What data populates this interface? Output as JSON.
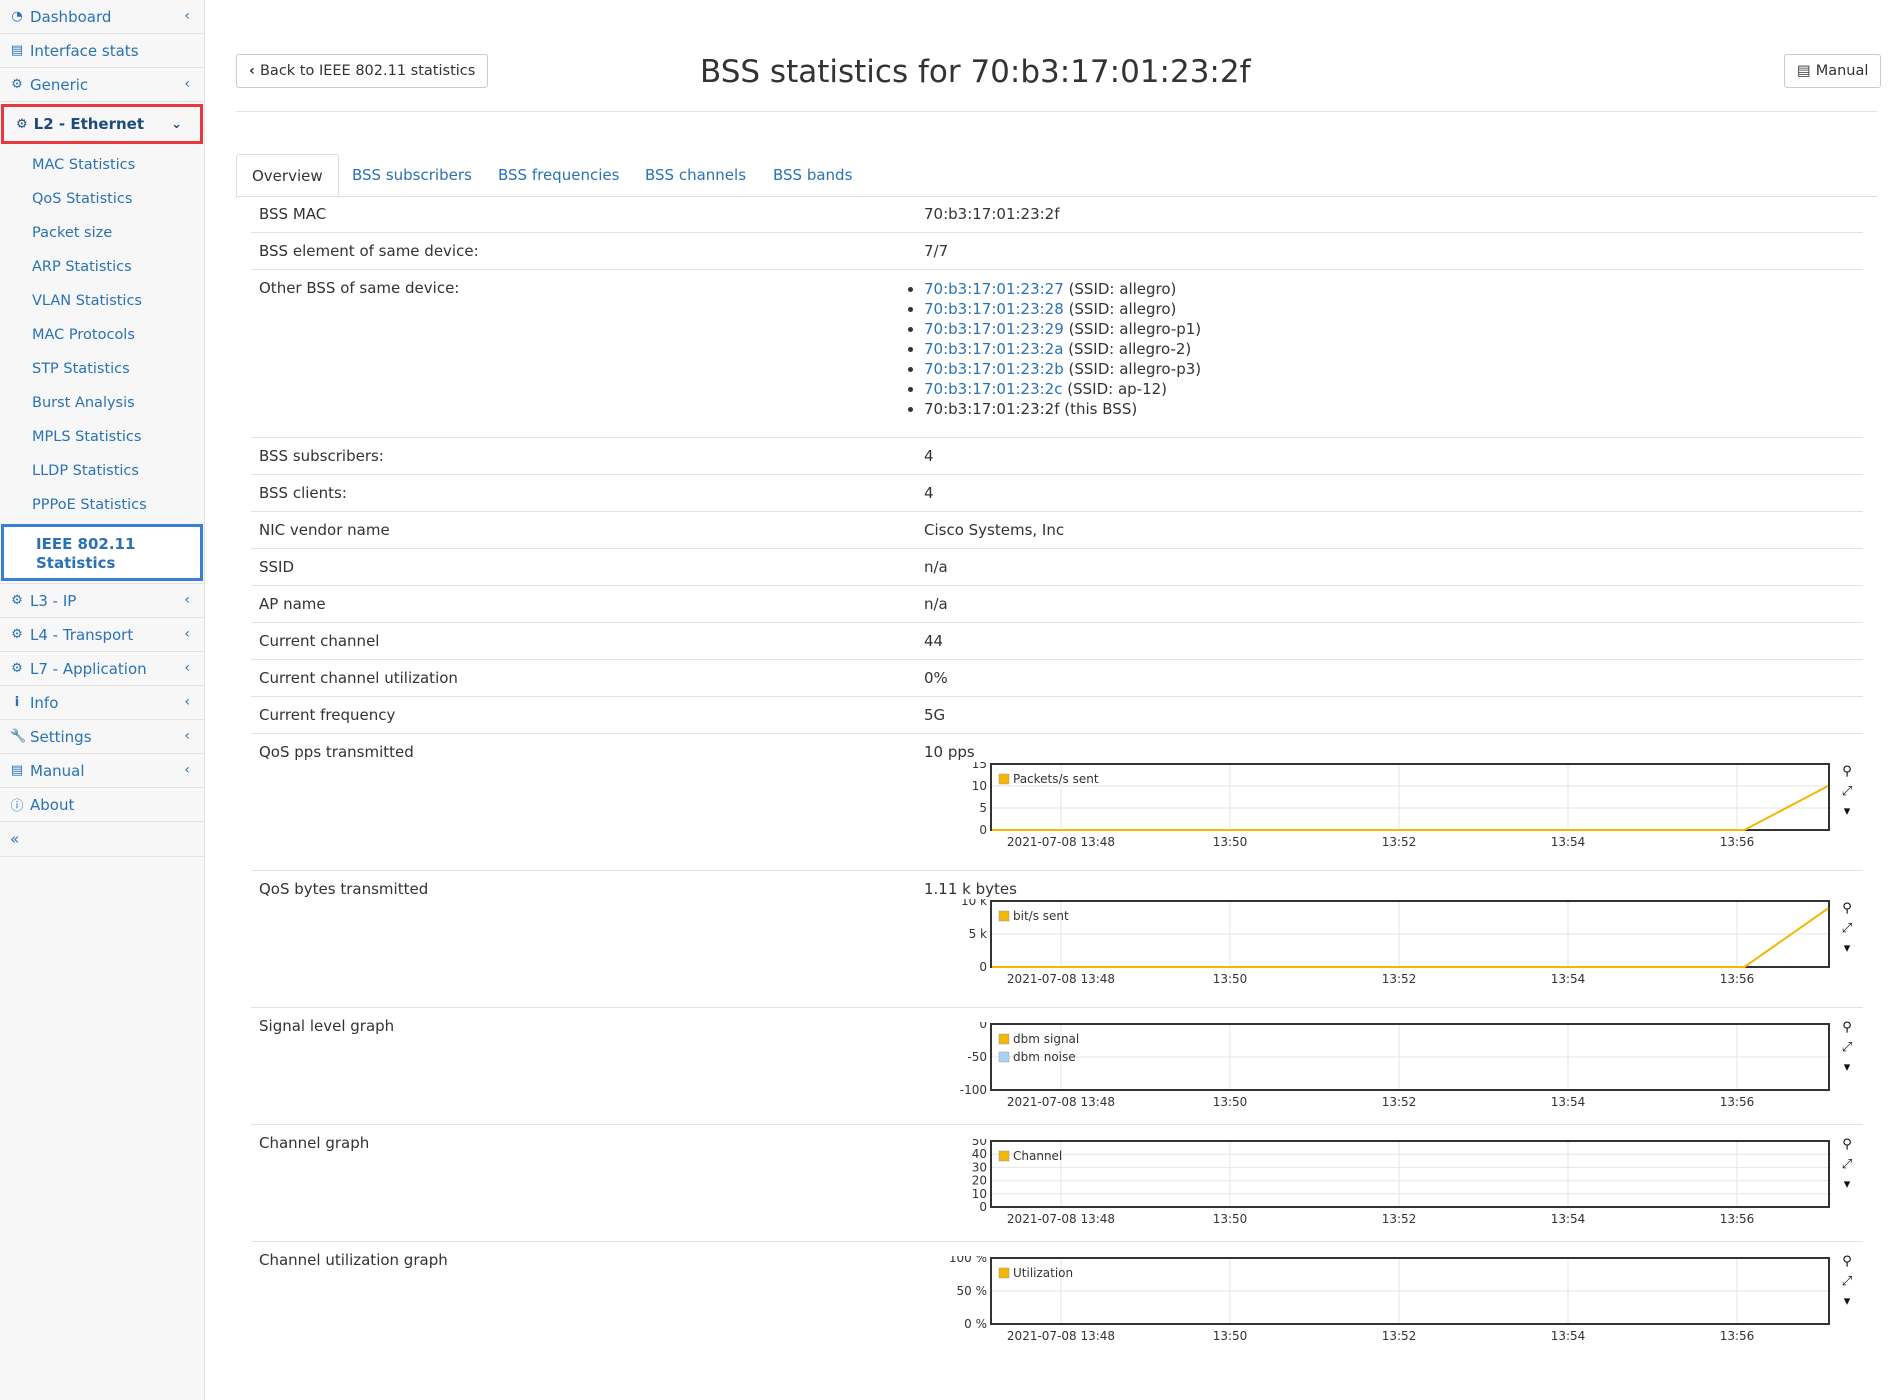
{
  "sidebar": {
    "top_items": [
      {
        "label": "Dashboard",
        "icon": "dashboard-icon"
      },
      {
        "label": "Interface stats",
        "icon": "bar-chart-icon"
      },
      {
        "label": "Generic",
        "icon": "gear-icon"
      }
    ],
    "l2_section": {
      "label": "L2 - Ethernet",
      "icon": "gear-icon"
    },
    "l2_items": [
      "MAC Statistics",
      "QoS Statistics",
      "Packet size",
      "ARP Statistics",
      "VLAN Statistics",
      "MAC Protocols",
      "STP Statistics",
      "Burst Analysis",
      "MPLS Statistics",
      "LLDP Statistics",
      "PPPoE Statistics"
    ],
    "l2_active_item": {
      "line1": "IEEE 802.11",
      "line2": "Statistics"
    },
    "bottom_items": [
      {
        "label": "L3 - IP",
        "icon": "gear-icon"
      },
      {
        "label": "L4 - Transport",
        "icon": "gear-icon"
      },
      {
        "label": "L7 - Application",
        "icon": "gear-icon"
      },
      {
        "label": "Info",
        "icon": "info-icon"
      },
      {
        "label": "Settings",
        "icon": "wrench-icon"
      },
      {
        "label": "Manual",
        "icon": "book-icon"
      },
      {
        "label": "About",
        "icon": "info-circle-icon"
      }
    ],
    "collapse_label": "«"
  },
  "header": {
    "back_label": "Back to IEEE 802.11 statistics",
    "title": "BSS statistics for 70:b3:17:01:23:2f",
    "manual_label": "Manual"
  },
  "tabs": [
    "Overview",
    "BSS subscribers",
    "BSS frequencies",
    "BSS channels",
    "BSS bands"
  ],
  "details": {
    "bss_mac": {
      "label": "BSS MAC",
      "value": "70:b3:17:01:23:2f"
    },
    "bss_element": {
      "label": "BSS element of same device:",
      "value": "7/7"
    },
    "other_bss": {
      "label": "Other BSS of same device:",
      "items": [
        {
          "mac": "70:b3:17:01:23:27",
          "ssid": "(SSID: allegro)"
        },
        {
          "mac": "70:b3:17:01:23:28",
          "ssid": "(SSID: allegro)"
        },
        {
          "mac": "70:b3:17:01:23:29",
          "ssid": "(SSID: allegro-p1)"
        },
        {
          "mac": "70:b3:17:01:23:2a",
          "ssid": "(SSID: allegro-2)"
        },
        {
          "mac": "70:b3:17:01:23:2b",
          "ssid": "(SSID: allegro-p3)"
        },
        {
          "mac": "70:b3:17:01:23:2c",
          "ssid": "(SSID: ap-12)"
        }
      ],
      "this_bss": "70:b3:17:01:23:2f (this BSS)"
    },
    "bss_subscribers": {
      "label": "BSS subscribers:",
      "value": "4"
    },
    "bss_clients": {
      "label": "BSS clients:",
      "value": "4"
    },
    "nic_vendor": {
      "label": "NIC vendor name",
      "value": "Cisco Systems, Inc"
    },
    "ssid": {
      "label": "SSID",
      "value": "n/a"
    },
    "ap_name": {
      "label": "AP name",
      "value": "n/a"
    },
    "current_channel": {
      "label": "Current channel",
      "value": "44"
    },
    "channel_util": {
      "label": "Current channel utilization",
      "value": "0%"
    },
    "current_freq": {
      "label": "Current frequency",
      "value": "5G"
    },
    "qos_pps": {
      "label": "QoS pps transmitted",
      "value": "10 pps"
    },
    "qos_bytes": {
      "label": "QoS bytes transmitted",
      "value": "1.11 k bytes"
    },
    "signal_graph": {
      "label": "Signal level graph"
    },
    "channel_graph": {
      "label": "Channel graph"
    },
    "util_graph": {
      "label": "Channel utilization graph"
    }
  },
  "chart_data": [
    {
      "type": "line",
      "y_ticks": [
        "15",
        "10",
        "5",
        "0"
      ],
      "ylim": [
        0,
        15
      ],
      "x_ticks": [
        "2021-07-08 13:48",
        "13:50",
        "13:52",
        "13:54",
        "13:56"
      ],
      "series": [
        {
          "name": "Packets/s sent",
          "color": "#f2b705",
          "values": [
            0,
            0,
            0,
            0,
            0,
            0,
            0,
            0,
            0,
            0,
            10
          ]
        }
      ]
    },
    {
      "type": "line",
      "y_ticks": [
        "10 k",
        "5 k",
        "0"
      ],
      "ylim": [
        0,
        10000
      ],
      "x_ticks": [
        "2021-07-08 13:48",
        "13:50",
        "13:52",
        "13:54",
        "13:56"
      ],
      "series": [
        {
          "name": "bit/s sent",
          "color": "#f2b705",
          "values": [
            0,
            0,
            0,
            0,
            0,
            0,
            0,
            0,
            0,
            0,
            8880
          ]
        }
      ]
    },
    {
      "type": "line",
      "y_ticks": [
        "0",
        "-50",
        "-100"
      ],
      "ylim": [
        -100,
        0
      ],
      "x_ticks": [
        "2021-07-08 13:48",
        "13:50",
        "13:52",
        "13:54",
        "13:56"
      ],
      "series": [
        {
          "name": "dbm signal",
          "color": "#f2b705",
          "values": []
        },
        {
          "name": "dbm noise",
          "color": "#a9d3f5",
          "values": []
        }
      ]
    },
    {
      "type": "line",
      "y_ticks": [
        "50",
        "40",
        "30",
        "20",
        "10",
        "0"
      ],
      "ylim": [
        0,
        50
      ],
      "x_ticks": [
        "2021-07-08 13:48",
        "13:50",
        "13:52",
        "13:54",
        "13:56"
      ],
      "series": [
        {
          "name": "Channel",
          "color": "#f2b705",
          "values": []
        }
      ]
    },
    {
      "type": "line",
      "y_ticks": [
        "100 %",
        "50 %",
        "0 %"
      ],
      "ylim": [
        0,
        100
      ],
      "x_ticks": [
        "2021-07-08 13:48",
        "13:50",
        "13:52",
        "13:54",
        "13:56"
      ],
      "series": [
        {
          "name": "Utilization",
          "color": "#f2b705",
          "values": []
        }
      ]
    }
  ],
  "chart_tools": {
    "zoom": "search-icon",
    "reset": "compress-icon",
    "menu": "caret-down-icon"
  }
}
